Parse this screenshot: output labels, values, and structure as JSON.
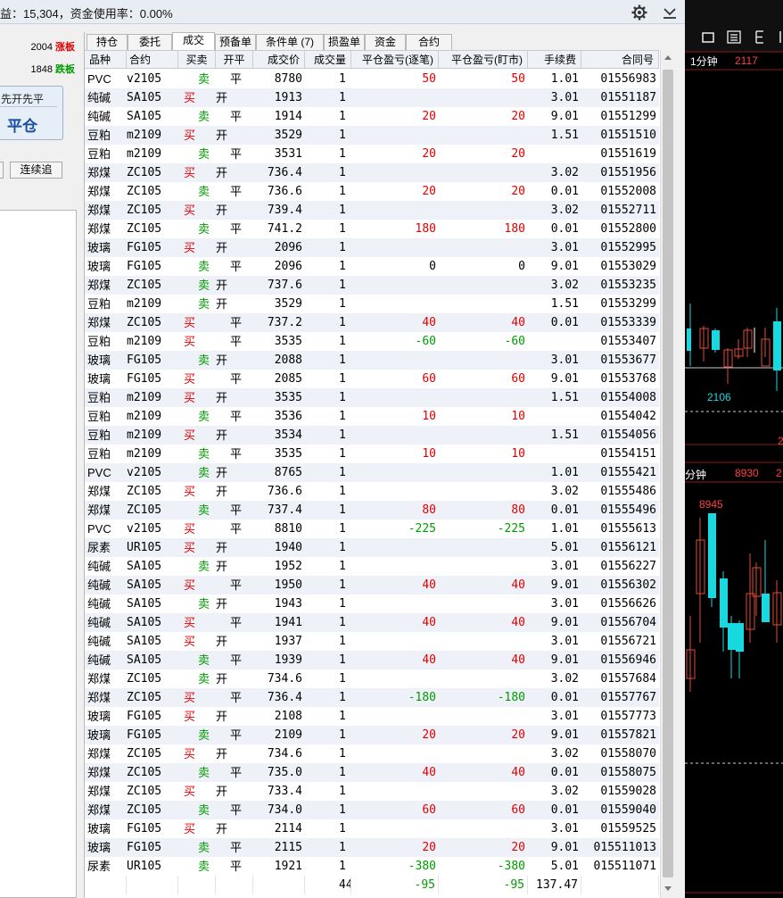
{
  "topbar": {
    "status": "益：15,304，资金使用率：0.00%",
    "gear_icon": "gear-icon",
    "collapse_icon": "chevron-down-icon"
  },
  "leftpanel": {
    "limit_up_price": "2004",
    "limit_up_label": "涨板",
    "limit_down_price": "1848",
    "limit_down_label": "跌板",
    "mode_label": "先开先平",
    "close_button": "平仓",
    "chase_button": "连续追"
  },
  "tabs": [
    "持仓",
    "委托",
    "成交",
    "预备单",
    "条件单 (7)",
    "损盈单",
    "资金",
    "合约"
  ],
  "active_tab": "成交",
  "columns": [
    "品种",
    "合约",
    "买卖",
    "开平",
    "成交价",
    "成交量",
    "平仓盈亏(逐笔)",
    "平仓盈亏(盯市)",
    "手续费",
    "合同号"
  ],
  "rows": [
    [
      "PVC",
      "v2105",
      "卖",
      "平",
      "8780",
      "1",
      "50",
      "50",
      "1.01",
      "01556983"
    ],
    [
      "纯碱",
      "SA105",
      "买",
      "开",
      "1913",
      "1",
      "",
      "",
      "3.01",
      "01551187"
    ],
    [
      "纯碱",
      "SA105",
      "卖",
      "平",
      "1914",
      "1",
      "20",
      "20",
      "9.01",
      "01551299"
    ],
    [
      "豆粕",
      "m2109",
      "买",
      "开",
      "3529",
      "1",
      "",
      "",
      "1.51",
      "01551510"
    ],
    [
      "豆粕",
      "m2109",
      "卖",
      "平",
      "3531",
      "1",
      "20",
      "20",
      "",
      "01551619"
    ],
    [
      "郑煤",
      "ZC105",
      "买",
      "开",
      "736.4",
      "1",
      "",
      "",
      "3.02",
      "01551956"
    ],
    [
      "郑煤",
      "ZC105",
      "卖",
      "平",
      "736.6",
      "1",
      "20",
      "20",
      "0.01",
      "01552008"
    ],
    [
      "郑煤",
      "ZC105",
      "买",
      "开",
      "739.4",
      "1",
      "",
      "",
      "3.02",
      "01552711"
    ],
    [
      "郑煤",
      "ZC105",
      "卖",
      "平",
      "741.2",
      "1",
      "180",
      "180",
      "0.01",
      "01552800"
    ],
    [
      "玻璃",
      "FG105",
      "买",
      "开",
      "2096",
      "1",
      "",
      "",
      "3.01",
      "01552995"
    ],
    [
      "玻璃",
      "FG105",
      "卖",
      "平",
      "2096",
      "1",
      "0",
      "0",
      "9.01",
      "01553029"
    ],
    [
      "郑煤",
      "ZC105",
      "卖",
      "开",
      "737.6",
      "1",
      "",
      "",
      "3.02",
      "01553235"
    ],
    [
      "豆粕",
      "m2109",
      "卖",
      "开",
      "3529",
      "1",
      "",
      "",
      "1.51",
      "01553299"
    ],
    [
      "郑煤",
      "ZC105",
      "买",
      "平",
      "737.2",
      "1",
      "40",
      "40",
      "0.01",
      "01553339"
    ],
    [
      "豆粕",
      "m2109",
      "买",
      "平",
      "3535",
      "1",
      "-60",
      "-60",
      "",
      "01553407"
    ],
    [
      "玻璃",
      "FG105",
      "卖",
      "开",
      "2088",
      "1",
      "",
      "",
      "3.01",
      "01553677"
    ],
    [
      "玻璃",
      "FG105",
      "买",
      "平",
      "2085",
      "1",
      "60",
      "60",
      "9.01",
      "01553768"
    ],
    [
      "豆粕",
      "m2109",
      "买",
      "开",
      "3535",
      "1",
      "",
      "",
      "1.51",
      "01554008"
    ],
    [
      "豆粕",
      "m2109",
      "卖",
      "平",
      "3536",
      "1",
      "10",
      "10",
      "",
      "01554042"
    ],
    [
      "豆粕",
      "m2109",
      "买",
      "开",
      "3534",
      "1",
      "",
      "",
      "1.51",
      "01554056"
    ],
    [
      "豆粕",
      "m2109",
      "卖",
      "平",
      "3535",
      "1",
      "10",
      "10",
      "",
      "01554151"
    ],
    [
      "PVC",
      "v2105",
      "卖",
      "开",
      "8765",
      "1",
      "",
      "",
      "1.01",
      "01555421"
    ],
    [
      "郑煤",
      "ZC105",
      "买",
      "开",
      "736.6",
      "1",
      "",
      "",
      "3.02",
      "01555486"
    ],
    [
      "郑煤",
      "ZC105",
      "卖",
      "平",
      "737.4",
      "1",
      "80",
      "80",
      "0.01",
      "01555496"
    ],
    [
      "PVC",
      "v2105",
      "买",
      "平",
      "8810",
      "1",
      "-225",
      "-225",
      "1.01",
      "01555613"
    ],
    [
      "尿素",
      "UR105",
      "买",
      "开",
      "1940",
      "1",
      "",
      "",
      "5.01",
      "01556121"
    ],
    [
      "纯碱",
      "SA105",
      "卖",
      "开",
      "1952",
      "1",
      "",
      "",
      "3.01",
      "01556227"
    ],
    [
      "纯碱",
      "SA105",
      "买",
      "平",
      "1950",
      "1",
      "40",
      "40",
      "9.01",
      "01556302"
    ],
    [
      "纯碱",
      "SA105",
      "卖",
      "开",
      "1943",
      "1",
      "",
      "",
      "3.01",
      "01556626"
    ],
    [
      "纯碱",
      "SA105",
      "买",
      "平",
      "1941",
      "1",
      "40",
      "40",
      "9.01",
      "01556704"
    ],
    [
      "纯碱",
      "SA105",
      "买",
      "开",
      "1937",
      "1",
      "",
      "",
      "3.01",
      "01556721"
    ],
    [
      "纯碱",
      "SA105",
      "卖",
      "平",
      "1939",
      "1",
      "40",
      "40",
      "9.01",
      "01556946"
    ],
    [
      "郑煤",
      "ZC105",
      "卖",
      "开",
      "734.6",
      "1",
      "",
      "",
      "3.02",
      "01557684"
    ],
    [
      "郑煤",
      "ZC105",
      "买",
      "平",
      "736.4",
      "1",
      "-180",
      "-180",
      "0.01",
      "01557767"
    ],
    [
      "玻璃",
      "FG105",
      "买",
      "开",
      "2108",
      "1",
      "",
      "",
      "3.01",
      "01557773"
    ],
    [
      "玻璃",
      "FG105",
      "卖",
      "平",
      "2109",
      "1",
      "20",
      "20",
      "9.01",
      "01557821"
    ],
    [
      "郑煤",
      "ZC105",
      "买",
      "开",
      "734.6",
      "1",
      "",
      "",
      "3.02",
      "01558070"
    ],
    [
      "郑煤",
      "ZC105",
      "卖",
      "平",
      "735.0",
      "1",
      "40",
      "40",
      "0.01",
      "01558075"
    ],
    [
      "郑煤",
      "ZC105",
      "买",
      "开",
      "733.4",
      "1",
      "",
      "",
      "3.02",
      "01559028"
    ],
    [
      "郑煤",
      "ZC105",
      "卖",
      "平",
      "734.0",
      "1",
      "60",
      "60",
      "0.01",
      "01559040"
    ],
    [
      "玻璃",
      "FG105",
      "买",
      "开",
      "2114",
      "1",
      "",
      "",
      "3.01",
      "01559525"
    ],
    [
      "玻璃",
      "FG105",
      "卖",
      "平",
      "2115",
      "1",
      "20",
      "20",
      "9.01",
      "015511013"
    ],
    [
      "尿素",
      "UR105",
      "卖",
      "平",
      "1921",
      "1",
      "-380",
      "-380",
      "5.01",
      "015511071"
    ]
  ],
  "totals": {
    "volume": "44",
    "pnl_each": "-95",
    "pnl_mtm": "-95",
    "fee": "137.47"
  },
  "chart": {
    "toolbar_icons": [
      "square-icon",
      "list-icon",
      "edit-icon"
    ],
    "upper_period": "1分钟",
    "upper_price": "2117",
    "upper_low_label": "2106",
    "lower_period": "分钟",
    "lower_price": "8930",
    "lower_price_2": "2",
    "lower_high_label": "8945",
    "edge_label": "2"
  },
  "colors": {
    "buy": "#e00000",
    "sell": "#009b00",
    "candle_up": "#e04a3a",
    "candle_down": "#18d8e0",
    "chart_bg": "#000000"
  }
}
